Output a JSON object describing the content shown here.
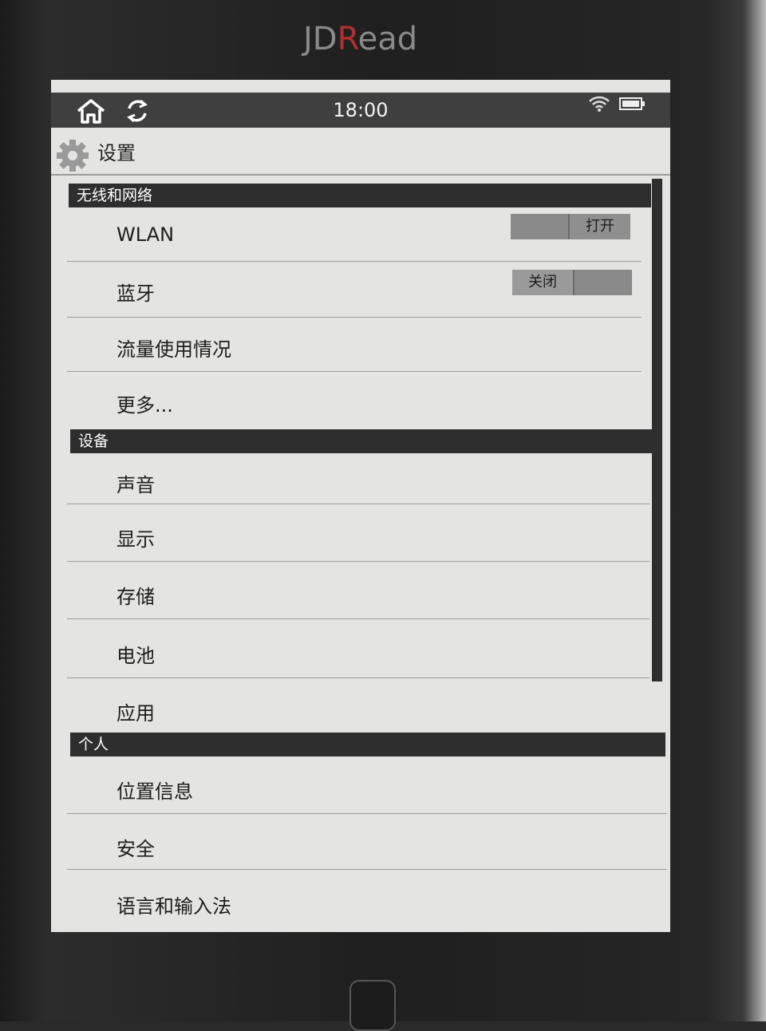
{
  "device": {
    "brand_prefix": "JD",
    "brand_accent": "R",
    "brand_suffix": "ead"
  },
  "statusbar": {
    "time": "18:00",
    "icons": [
      "home-icon",
      "sync-icon",
      "wifi-icon",
      "battery-icon"
    ]
  },
  "header": {
    "title": "设置",
    "icon": "gear-icon"
  },
  "sections": [
    {
      "title": "无线和网络",
      "items": [
        {
          "label": "WLAN",
          "toggle": "打开"
        },
        {
          "label": "蓝牙",
          "toggle": "关闭"
        },
        {
          "label": "流量使用情况"
        },
        {
          "label": "更多..."
        }
      ]
    },
    {
      "title": "设备",
      "items": [
        {
          "label": "声音"
        },
        {
          "label": "显示"
        },
        {
          "label": "存储"
        },
        {
          "label": "电池"
        },
        {
          "label": "应用"
        }
      ]
    },
    {
      "title": "个人",
      "items": [
        {
          "label": "位置信息"
        },
        {
          "label": "安全"
        },
        {
          "label": "语言和输入法"
        }
      ]
    }
  ],
  "colors": {
    "screen_bg": "#e4e5e2",
    "bar_dark": "#2e2e2e",
    "brand_accent": "#b03030"
  }
}
